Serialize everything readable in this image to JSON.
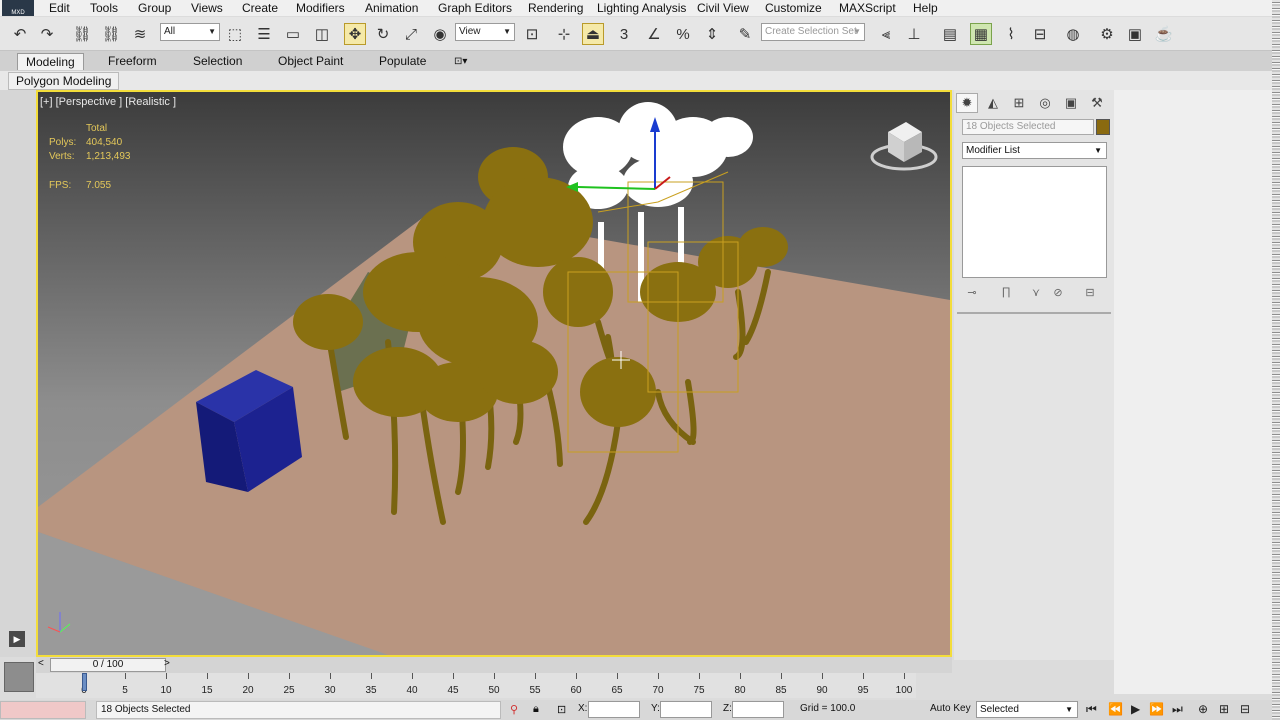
{
  "app": {
    "icon_label": "MXD"
  },
  "menu": [
    "Edit",
    "Tools",
    "Group",
    "Views",
    "Create",
    "Modifiers",
    "Animation",
    "Graph Editors",
    "Rendering",
    "Lighting Analysis",
    "Civil View",
    "Customize",
    "MAXScript",
    "Help"
  ],
  "toolbar": {
    "filter_value": "All",
    "refcoord_value": "View",
    "selection_set_placeholder": "Create Selection Set",
    "snap_label": "3"
  },
  "ribbon": {
    "tabs": [
      "Modeling",
      "Freeform",
      "Selection",
      "Object Paint",
      "Populate"
    ],
    "active_tab": "Modeling",
    "subpanel": "Polygon Modeling"
  },
  "viewport": {
    "label": "[+] [Perspective ] [Realistic ]",
    "stats": {
      "header": "Total",
      "polys_label": "Polys:",
      "polys_value": "404,540",
      "verts_label": "Verts:",
      "verts_value": "1,213,493",
      "fps_label": "FPS:",
      "fps_value": "7.055"
    }
  },
  "command_panel": {
    "selection_name": "18 Objects Selected",
    "modifier_list": "Modifier List",
    "object_color": "#8a6a10"
  },
  "timeline": {
    "frame_display": "0 / 100",
    "ticks": [
      0,
      5,
      10,
      15,
      20,
      25,
      30,
      35,
      40,
      45,
      50,
      55,
      60,
      65,
      70,
      75,
      80,
      85,
      90,
      95,
      100
    ]
  },
  "status": {
    "selection_text": "18 Objects Selected",
    "x_label": "X:",
    "y_label": "Y:",
    "z_label": "Z:",
    "grid_text": "Grid = 100.0",
    "autokey_label": "Auto Key",
    "key_mode": "Selected"
  },
  "colors": {
    "viewport_border": "#f3dd3a",
    "palm_color": "#8a7010",
    "ground_color": "#b89580",
    "box_color": "#141a78"
  }
}
